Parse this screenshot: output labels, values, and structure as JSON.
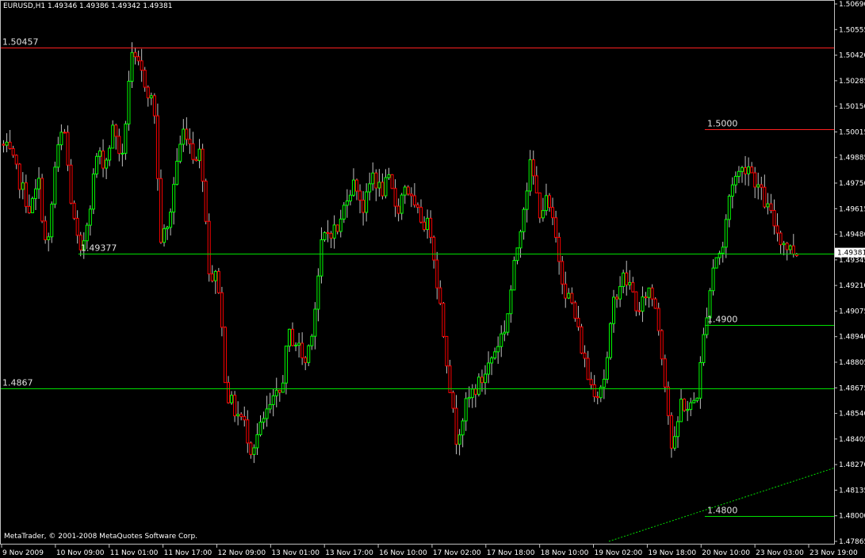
{
  "window": {
    "title": "EURUSD,H1  1.49346 1.49386 1.49342 1.49381",
    "copyright": "MetaTrader, © 2001-2008 MetaQuotes Software Corp."
  },
  "colors": {
    "background": "#000000",
    "frame": "#c0c0c0",
    "bull": "#00ff00",
    "bear": "#ff0000",
    "wick": "#c0c0c0",
    "level_red": "#ff2020",
    "level_green": "#00e000",
    "trend": "#00e000"
  },
  "chart_data": {
    "type": "candlestick",
    "symbol": "EURUSD",
    "timeframe": "H1",
    "ylim": [
      1.47865,
      1.5069
    ],
    "y_ticks": [
      "1.50690",
      "1.50555",
      "1.50420",
      "1.50285",
      "1.50150",
      "1.50015",
      "1.49885",
      "1.49750",
      "1.49615",
      "1.49480",
      "1.49345",
      "1.49210",
      "1.49075",
      "1.48940",
      "1.48805",
      "1.48675",
      "1.48540",
      "1.48405",
      "1.48270",
      "1.48135",
      "1.48000",
      "1.47865"
    ],
    "x_ticks": [
      "9 Nov 2009",
      "10 Nov 09:00",
      "11 Nov 01:00",
      "11 Nov 17:00",
      "12 Nov 09:00",
      "13 Nov 01:00",
      "13 Nov 17:00",
      "16 Nov 10:00",
      "17 Nov 02:00",
      "17 Nov 18:00",
      "18 Nov 10:00",
      "19 Nov 02:00",
      "19 Nov 18:00",
      "20 Nov 10:00",
      "23 Nov 03:00",
      "23 Nov 19:00"
    ],
    "current_price": "1.49381",
    "levels": [
      {
        "label": "1.50457",
        "value": 1.50457,
        "color": "red",
        "x_start": 0.0
      },
      {
        "label": "1.5000",
        "value": 1.5003,
        "color": "red",
        "x_start": 0.845
      },
      {
        "label": "1.49377",
        "value": 1.49377,
        "color": "green",
        "x_start": 0.094
      },
      {
        "label": "1.4900",
        "value": 1.49,
        "color": "green",
        "x_start": 0.845
      },
      {
        "label": "1.4867",
        "value": 1.4867,
        "color": "green",
        "x_start": 0.0
      },
      {
        "label": "1.4800",
        "value": 1.48,
        "color": "green",
        "x_start": 0.845
      }
    ],
    "trendline": {
      "start": [
        0.73,
        1.47865
      ],
      "end": [
        1.0,
        1.4825
      ]
    },
    "path": [
      [
        0.0,
        1.4995
      ],
      [
        0.01,
        1.499
      ],
      [
        0.02,
        1.4978
      ],
      [
        0.035,
        1.496
      ],
      [
        0.045,
        1.4975
      ],
      [
        0.055,
        1.4935
      ],
      [
        0.065,
        1.4985
      ],
      [
        0.075,
        1.5005
      ],
      [
        0.085,
        1.496
      ],
      [
        0.095,
        1.4935
      ],
      [
        0.105,
        1.496
      ],
      [
        0.115,
        1.499
      ],
      [
        0.125,
        1.4985
      ],
      [
        0.135,
        1.5005
      ],
      [
        0.145,
        1.4985
      ],
      [
        0.155,
        1.504
      ],
      [
        0.165,
        1.5035
      ],
      [
        0.175,
        1.5025
      ],
      [
        0.185,
        1.501
      ],
      [
        0.19,
        1.4945
      ],
      [
        0.2,
        1.495
      ],
      [
        0.21,
        1.4985
      ],
      [
        0.22,
        1.5005
      ],
      [
        0.23,
        1.499
      ],
      [
        0.24,
        1.499
      ],
      [
        0.25,
        1.4925
      ],
      [
        0.26,
        1.4925
      ],
      [
        0.27,
        1.4865
      ],
      [
        0.28,
        1.4855
      ],
      [
        0.29,
        1.485
      ],
      [
        0.3,
        1.4835
      ],
      [
        0.31,
        1.4845
      ],
      [
        0.32,
        1.4855
      ],
      [
        0.335,
        1.4865
      ],
      [
        0.345,
        1.4895
      ],
      [
        0.355,
        1.489
      ],
      [
        0.365,
        1.488
      ],
      [
        0.375,
        1.4905
      ],
      [
        0.385,
        1.4945
      ],
      [
        0.395,
        1.495
      ],
      [
        0.405,
        1.495
      ],
      [
        0.415,
        1.497
      ],
      [
        0.425,
        1.4975
      ],
      [
        0.435,
        1.496
      ],
      [
        0.445,
        1.498
      ],
      [
        0.455,
        1.497
      ],
      [
        0.465,
        1.4975
      ],
      [
        0.475,
        1.496
      ],
      [
        0.485,
        1.4975
      ],
      [
        0.495,
        1.496
      ],
      [
        0.505,
        1.4955
      ],
      [
        0.515,
        1.495
      ],
      [
        0.525,
        1.4915
      ],
      [
        0.535,
        1.488
      ],
      [
        0.545,
        1.484
      ],
      [
        0.555,
        1.4855
      ],
      [
        0.565,
        1.4865
      ],
      [
        0.575,
        1.487
      ],
      [
        0.585,
        1.488
      ],
      [
        0.595,
        1.489
      ],
      [
        0.605,
        1.49
      ],
      [
        0.615,
        1.493
      ],
      [
        0.625,
        1.496
      ],
      [
        0.635,
        1.4985
      ],
      [
        0.645,
        1.496
      ],
      [
        0.655,
        1.4965
      ],
      [
        0.665,
        1.4945
      ],
      [
        0.675,
        1.492
      ],
      [
        0.685,
        1.491
      ],
      [
        0.695,
        1.489
      ],
      [
        0.705,
        1.487
      ],
      [
        0.715,
        1.4865
      ],
      [
        0.725,
        1.4875
      ],
      [
        0.735,
        1.4915
      ],
      [
        0.745,
        1.4925
      ],
      [
        0.755,
        1.492
      ],
      [
        0.765,
        1.4905
      ],
      [
        0.775,
        1.492
      ],
      [
        0.785,
        1.491
      ],
      [
        0.795,
        1.4875
      ],
      [
        0.805,
        1.483
      ],
      [
        0.815,
        1.486
      ],
      [
        0.825,
        1.4855
      ],
      [
        0.835,
        1.4865
      ],
      [
        0.845,
        1.4905
      ],
      [
        0.855,
        1.4935
      ],
      [
        0.865,
        1.494
      ],
      [
        0.875,
        1.4975
      ],
      [
        0.885,
        1.498
      ],
      [
        0.895,
        1.4985
      ],
      [
        0.905,
        1.4975
      ],
      [
        0.915,
        1.4965
      ],
      [
        0.925,
        1.4955
      ],
      [
        0.935,
        1.4945
      ],
      [
        0.945,
        1.494
      ],
      [
        0.955,
        1.4938
      ]
    ]
  }
}
